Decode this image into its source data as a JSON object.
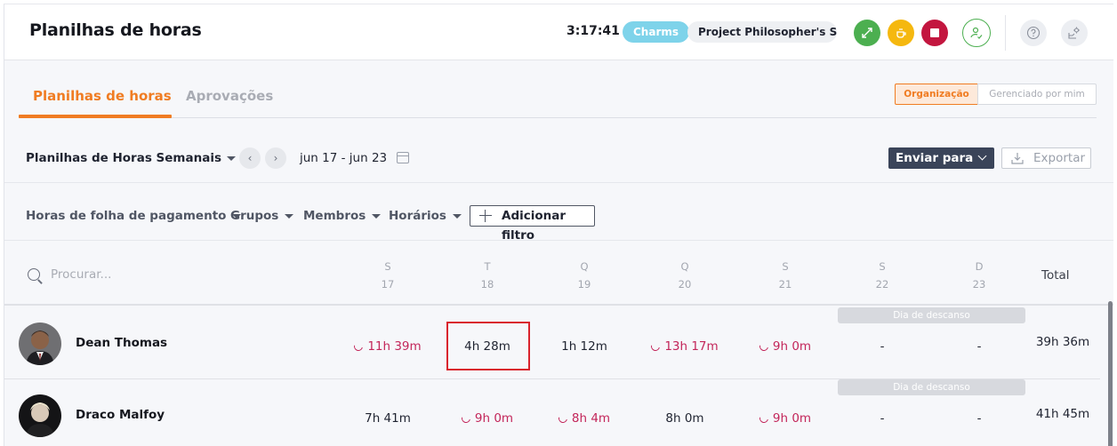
{
  "app": {
    "title": "Planilhas de horas",
    "timer": "3:17:41",
    "project_tag": "Charms",
    "project_name": "Project Philosopher's S...",
    "actions": {
      "switch_icon": "switch-task-icon",
      "break_icon": "coffee-break-icon",
      "stop_icon": "stop-icon",
      "user_icon": "user-check-icon",
      "help_icon": "help-icon",
      "settings_icon": "settings-icon"
    },
    "colors": {
      "accent": "#f07c22",
      "switch": "#4caf50",
      "break": "#f5b80f",
      "stop": "#c3163f",
      "project_tag": "#7ed3ea",
      "overtime": "#c3265a",
      "send_button": "#3a4459"
    }
  },
  "tabs": [
    {
      "label": "Planilhas de horas",
      "active": true
    },
    {
      "label": "Aprovações",
      "active": false
    }
  ],
  "scope_toggle": {
    "options": [
      "Organização",
      "Gerenciado por mim"
    ],
    "selected": "Organização"
  },
  "toolbar": {
    "view_select": "Planilhas de Horas Semanais",
    "prev_label": "‹",
    "next_label": "›",
    "date_range": "jun 17 - jun 23",
    "send_label": "Enviar para",
    "export_label": "Exportar"
  },
  "filters": {
    "items": [
      "Horas de folha de pagamento",
      "Grupos",
      "Membros",
      "Horários"
    ],
    "add_label": "Adicionar filtro"
  },
  "table": {
    "search_placeholder": "Procurar...",
    "days": [
      {
        "letter": "S",
        "date": "17"
      },
      {
        "letter": "T",
        "date": "18"
      },
      {
        "letter": "Q",
        "date": "19"
      },
      {
        "letter": "Q",
        "date": "20"
      },
      {
        "letter": "S",
        "date": "21"
      },
      {
        "letter": "S",
        "date": "22"
      },
      {
        "letter": "D",
        "date": "23"
      }
    ],
    "total_label": "Total",
    "rest_day_label": "Dia de descanso",
    "rows": [
      {
        "name": "Dean Thomas",
        "cells": [
          {
            "value": "11h 39m",
            "overtime": true
          },
          {
            "value": "4h 28m",
            "overtime": false,
            "highlighted": true
          },
          {
            "value": "1h 12m",
            "overtime": false
          },
          {
            "value": "13h 17m",
            "overtime": true
          },
          {
            "value": "9h 0m",
            "overtime": true
          },
          {
            "value": "-",
            "overtime": false
          },
          {
            "value": "-",
            "overtime": false
          }
        ],
        "total": "39h 36m"
      },
      {
        "name": "Draco Malfoy",
        "cells": [
          {
            "value": "7h 41m",
            "overtime": false
          },
          {
            "value": "9h 0m",
            "overtime": true
          },
          {
            "value": "8h 4m",
            "overtime": true
          },
          {
            "value": "8h 0m",
            "overtime": false
          },
          {
            "value": "9h 0m",
            "overtime": true
          },
          {
            "value": "-",
            "overtime": false
          },
          {
            "value": "-",
            "overtime": false
          }
        ],
        "total": "41h 45m"
      }
    ]
  }
}
